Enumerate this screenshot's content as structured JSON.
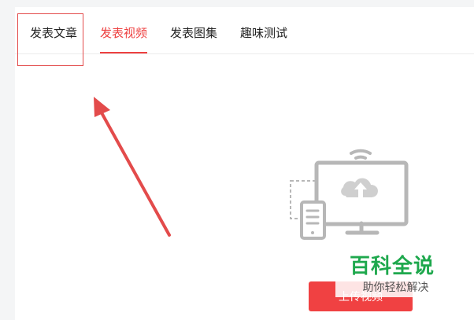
{
  "tabs": [
    {
      "label": "发表文章",
      "active": false
    },
    {
      "label": "发表视频",
      "active": true
    },
    {
      "label": "发表图集",
      "active": false
    },
    {
      "label": "趣味测试",
      "active": false
    }
  ],
  "main": {
    "upload_button_label": "上传视频"
  },
  "watermark": {
    "title": "百科全说",
    "subtitle": "助你轻松解决"
  },
  "colors": {
    "accent": "#ed4040",
    "annotation": "#e34b4b",
    "watermark_green": "#1ea84d",
    "illustration_gray": "#b7b7b7"
  },
  "icons": {
    "illustration": "upload-devices-icon",
    "arrow": "annotation-arrow-icon"
  }
}
